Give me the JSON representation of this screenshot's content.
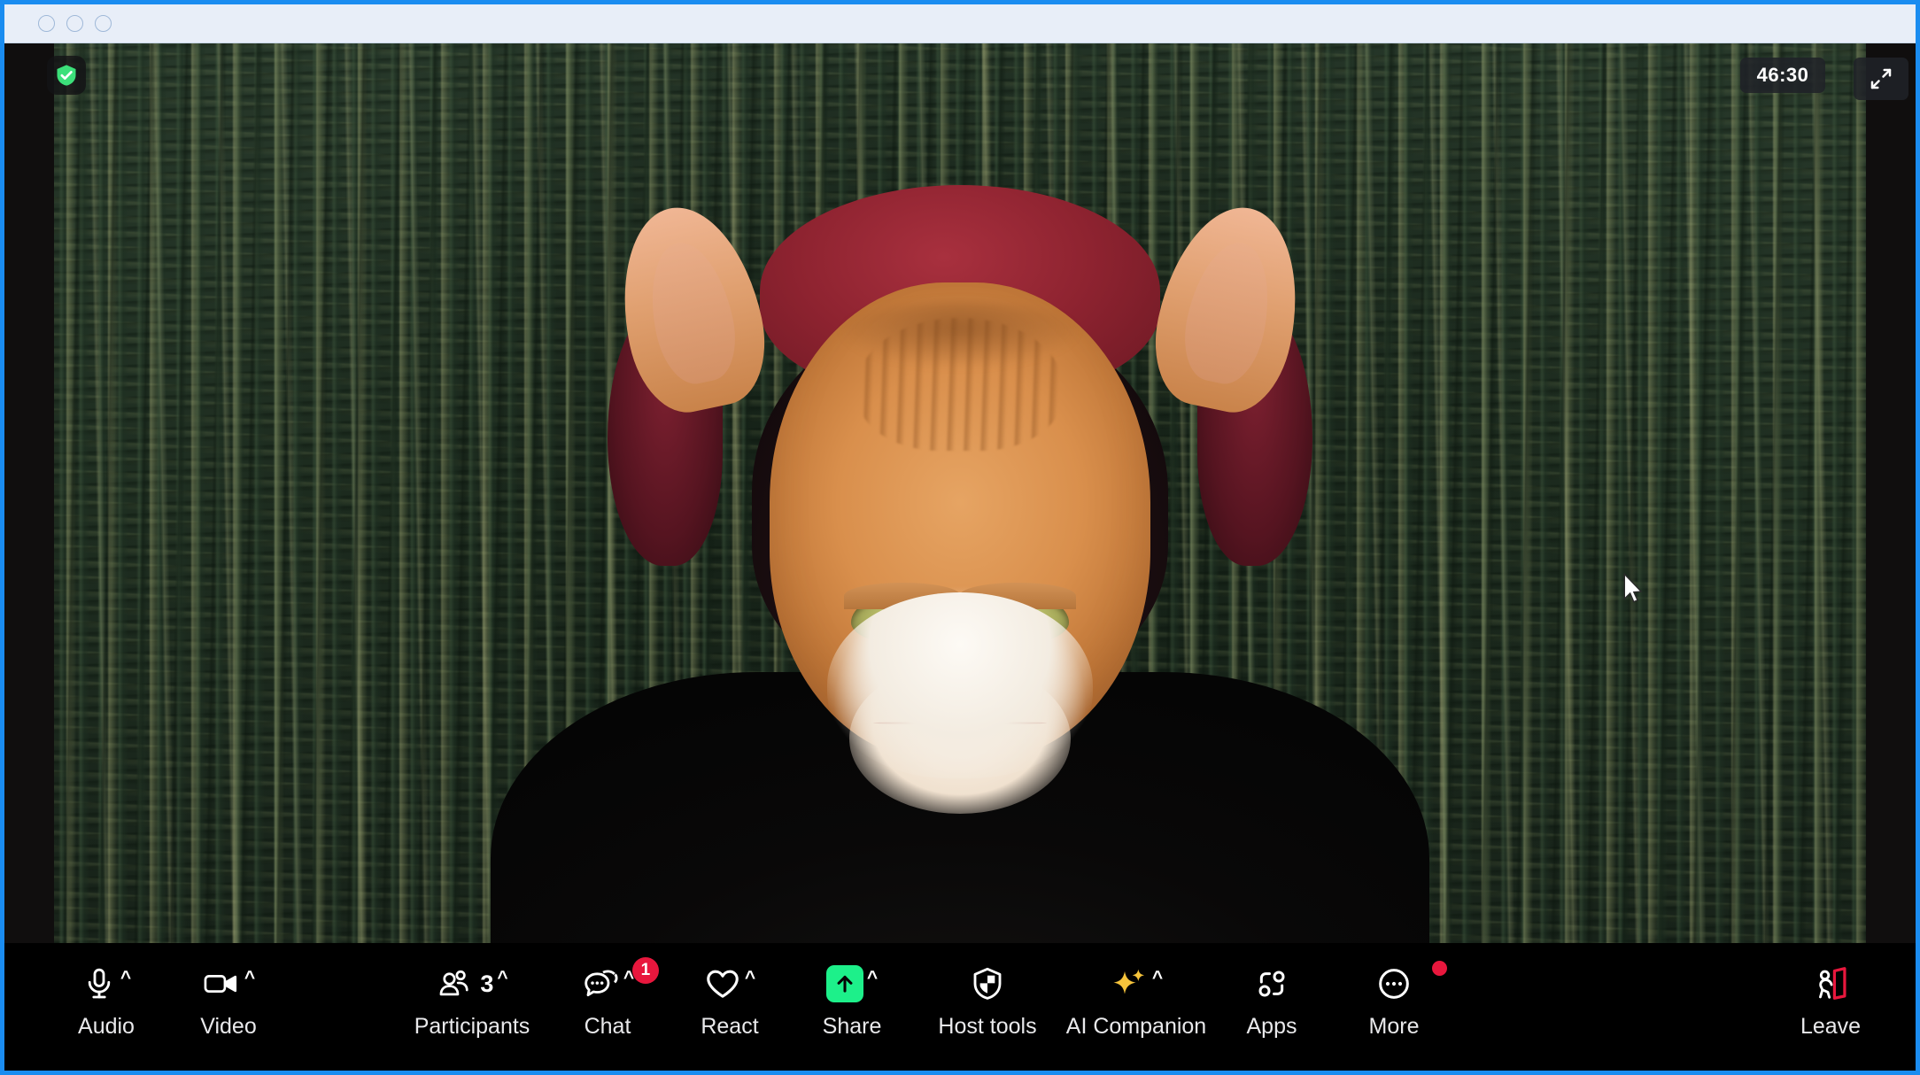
{
  "window": {
    "traffic_lights": [
      "close",
      "minimize",
      "maximize"
    ],
    "border_color": "#1a8cf0",
    "titlebar_color": "#e8eef8"
  },
  "video": {
    "encryption_icon": "shield-check-icon",
    "encryption_color": "#3ce07a",
    "timer": "46:30",
    "fullscreen_icon": "expand-diagonal-icon",
    "background_name": "evergreen-forest-virtual-background",
    "avatar_filter": "cat-face-ar-filter",
    "cursor_icon": "arrow-cursor"
  },
  "toolbar": {
    "background_color": "#000000",
    "items": [
      {
        "id": "audio",
        "label": "Audio",
        "icon": "microphone-icon",
        "caret": "^",
        "badge": null,
        "count": null
      },
      {
        "id": "video",
        "label": "Video",
        "icon": "video-camera-icon",
        "caret": "^",
        "badge": null,
        "count": null
      },
      {
        "id": "participants",
        "label": "Participants",
        "icon": "people-icon",
        "caret": "^",
        "badge": null,
        "count": "3"
      },
      {
        "id": "chat",
        "label": "Chat",
        "icon": "chat-bubble-icon",
        "caret": "^",
        "badge": "1",
        "count": null
      },
      {
        "id": "react",
        "label": "React",
        "icon": "heart-icon",
        "caret": "^",
        "badge": null,
        "count": null
      },
      {
        "id": "share",
        "label": "Share",
        "icon": "share-arrow-up-icon",
        "caret": "^",
        "badge": null,
        "count": null
      },
      {
        "id": "host_tools",
        "label": "Host tools",
        "icon": "shield-icon",
        "caret": "",
        "badge": null,
        "count": null
      },
      {
        "id": "ai_companion",
        "label": "AI Companion",
        "icon": "sparkles-icon",
        "caret": "^",
        "badge": null,
        "count": null
      },
      {
        "id": "apps",
        "label": "Apps",
        "icon": "apps-nodes-icon",
        "caret": "",
        "badge": null,
        "count": null
      },
      {
        "id": "more",
        "label": "More",
        "icon": "ellipsis-circle-icon",
        "caret": "",
        "badge": "dot",
        "count": null
      }
    ],
    "leave": {
      "label": "Leave",
      "icon": "leave-door-icon",
      "accent_color": "#e8173d"
    },
    "badge_color": "#e8173d",
    "share_accent": "#1df08a",
    "ai_accent": "#f5c33b"
  }
}
